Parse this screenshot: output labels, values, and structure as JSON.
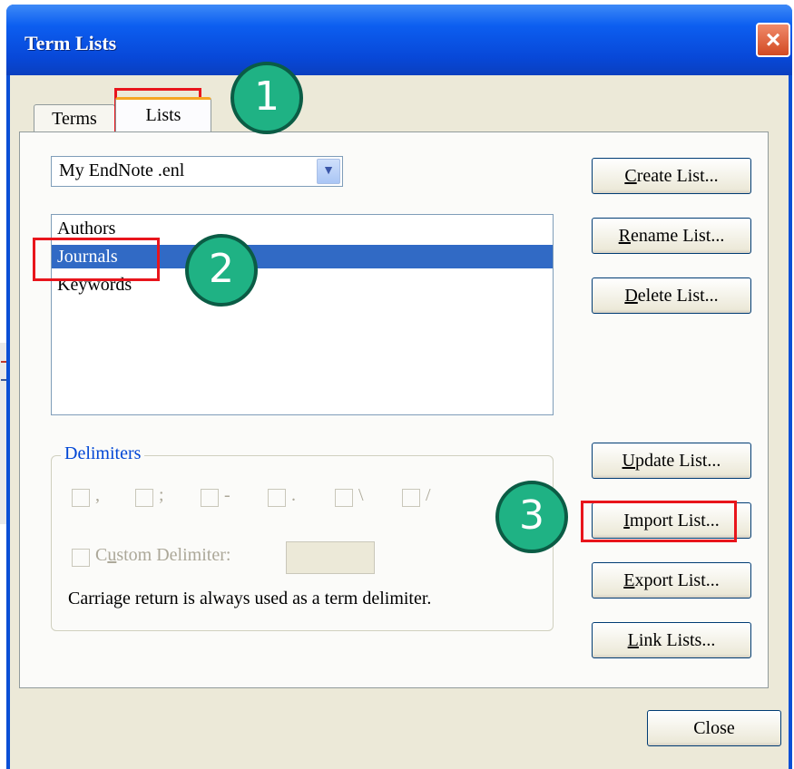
{
  "window": {
    "title": "Term Lists",
    "close_glyph": "×"
  },
  "tabs": [
    {
      "label": "Terms",
      "active": false
    },
    {
      "label": "Lists",
      "active": true
    }
  ],
  "library_dropdown": {
    "value": "My EndNote .enl",
    "arrow_icon": "chevron-down-icon"
  },
  "lists": [
    {
      "label": "Authors",
      "selected": false
    },
    {
      "label": "Journals",
      "selected": true
    },
    {
      "label": "Keywords",
      "selected": false
    }
  ],
  "buttons": {
    "create": {
      "underline": "C",
      "rest": "reate List..."
    },
    "rename": {
      "underline": "R",
      "rest": "ename List..."
    },
    "delete": {
      "underline": "D",
      "rest": "elete List..."
    },
    "update": {
      "underline": "U",
      "rest": "pdate List..."
    },
    "import": {
      "underline": "I",
      "rest": "mport List..."
    },
    "export": {
      "underline": "E",
      "rest": "xport List..."
    },
    "link": {
      "underline": "L",
      "rest": "ink Lists..."
    },
    "close": "Close"
  },
  "delimiters": {
    "legend": "Delimiters",
    "options": [
      ",",
      ";",
      "-",
      ".",
      "\\",
      "/"
    ],
    "custom_label_pre": "C",
    "custom_label_u": "u",
    "custom_label_post": "stom Delimiter:",
    "custom_value": "",
    "note": "Carriage return is always used as a term delimiter."
  },
  "annotations": [
    {
      "number": "1"
    },
    {
      "number": "2"
    },
    {
      "number": "3"
    }
  ],
  "colors": {
    "selection": "#316ac5",
    "annotation_red": "#e8151c",
    "badge_green": "#1fb284",
    "titlebar_blue": "#0c5ef0"
  }
}
